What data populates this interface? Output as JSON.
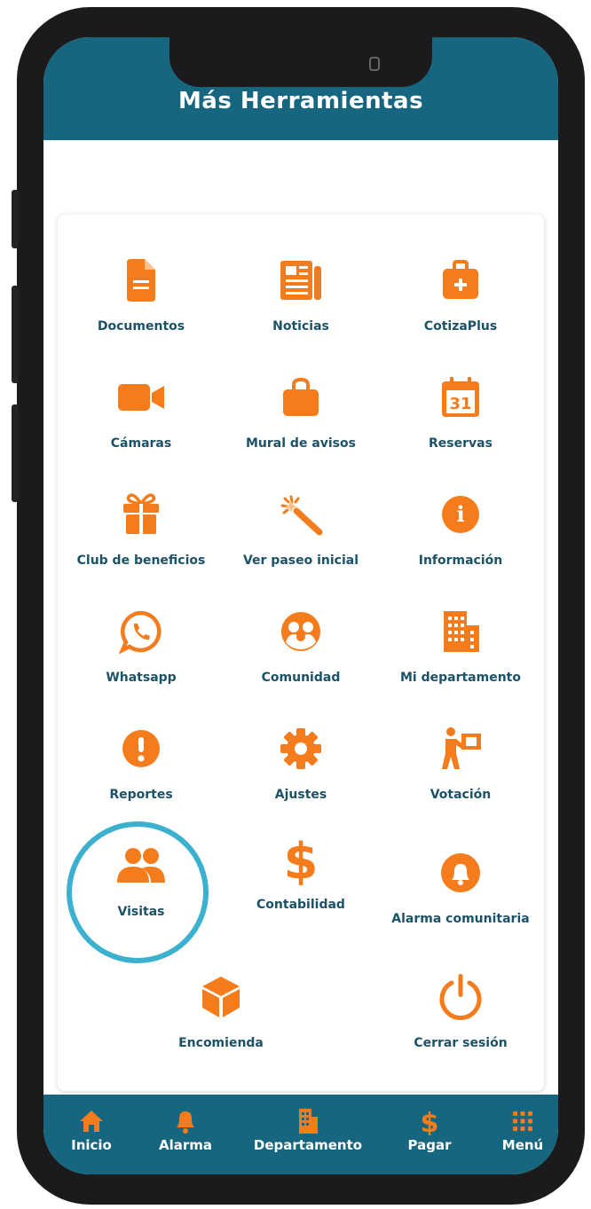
{
  "header": {
    "title": "Más Herramientas"
  },
  "colors": {
    "primary": "#17667f",
    "accent": "#f47c1c",
    "label": "#1c5268",
    "highlight": "#3bb0cf"
  },
  "tools": [
    {
      "label": "Documentos",
      "icon": "document-icon"
    },
    {
      "label": "Noticias",
      "icon": "newspaper-icon"
    },
    {
      "label": "CotizaPlus",
      "icon": "medical-bag-icon"
    },
    {
      "label": "Cámaras",
      "icon": "video-camera-icon"
    },
    {
      "label": "Mural de avisos",
      "icon": "shopping-bag-icon"
    },
    {
      "label": "Reservas",
      "icon": "calendar-icon",
      "icon_text": "31"
    },
    {
      "label": "Club de beneficios",
      "icon": "gift-icon"
    },
    {
      "label": "Ver paseo inicial",
      "icon": "magic-wand-icon"
    },
    {
      "label": "Información",
      "icon": "info-icon"
    },
    {
      "label": "Whatsapp",
      "icon": "whatsapp-icon"
    },
    {
      "label": "Comunidad",
      "icon": "community-icon"
    },
    {
      "label": "Mi departamento",
      "icon": "building-icon"
    },
    {
      "label": "Reportes",
      "icon": "alert-icon"
    },
    {
      "label": "Ajustes",
      "icon": "gear-icon"
    },
    {
      "label": "Votación",
      "icon": "vote-icon"
    },
    {
      "label": "Visitas",
      "icon": "users-icon"
    },
    {
      "label": "Contabilidad",
      "icon": "dollar-icon"
    },
    {
      "label": "Alarma comunitaria",
      "icon": "bell-icon"
    },
    {
      "label": "Encomienda",
      "icon": "package-icon"
    },
    {
      "label": "Cerrar sesión",
      "icon": "power-icon"
    }
  ],
  "bottom_nav": [
    {
      "label": "Inicio",
      "icon": "home-icon"
    },
    {
      "label": "Alarma",
      "icon": "bell-icon"
    },
    {
      "label": "Departamento",
      "icon": "building-icon"
    },
    {
      "label": "Pagar",
      "icon": "dollar-icon"
    },
    {
      "label": "Menú",
      "icon": "grid-icon"
    }
  ]
}
